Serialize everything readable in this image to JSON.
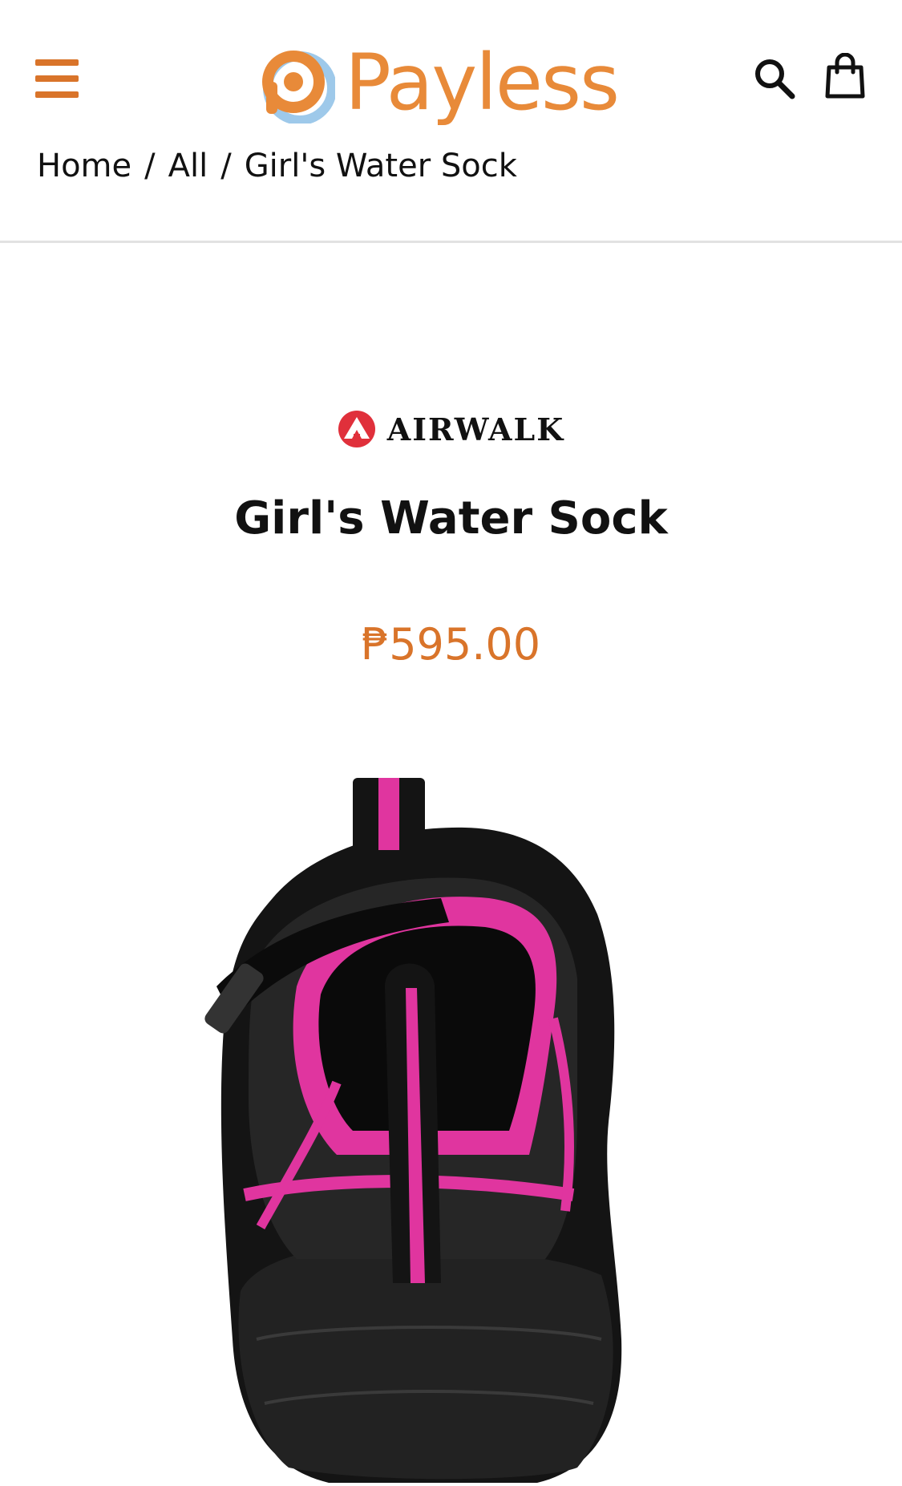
{
  "header": {
    "logo_text": "Payless",
    "menu_icon": "hamburger-menu-icon",
    "search_icon": "search-icon",
    "cart_icon": "shopping-bag-icon"
  },
  "breadcrumb": {
    "items": [
      "Home",
      "All",
      "Girl's Water Sock"
    ],
    "separator": "/"
  },
  "product": {
    "brand": "AIRWALK",
    "title": "Girl's Water Sock",
    "price": "₱595.00",
    "image_alt_icon": "water-shoe-image"
  },
  "colors": {
    "accent": "#d9742a",
    "logo_orange": "#e88a39",
    "logo_blue": "#9ec9ea",
    "brand_red": "#e0303b",
    "shoe_black": "#141414",
    "shoe_pink": "#e0359f"
  }
}
